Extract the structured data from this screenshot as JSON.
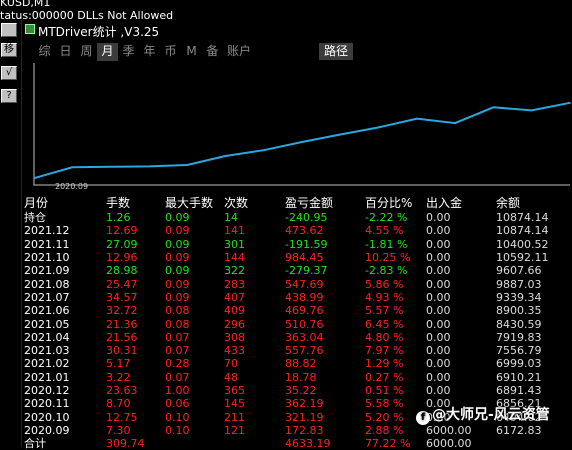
{
  "status": {
    "line1": "KUSD,M1",
    "line2": "tatus:000000 DLLs Not Allowed"
  },
  "side_buttons": [
    {
      "name": "side-button-1",
      "label": ""
    },
    {
      "name": "side-button-2",
      "label": "移"
    },
    {
      "name": "side-button-3",
      "label": "√"
    },
    {
      "name": "side-button-4",
      "label": "?"
    }
  ],
  "window": {
    "title": "MTDriver统计 ,V3.25"
  },
  "tabs": [
    "综",
    "日",
    "周",
    "月",
    "季",
    "年",
    "币",
    "M",
    "备",
    "账户"
  ],
  "active_tab": "月",
  "path_tab": "路径",
  "chart_data": {
    "type": "line",
    "x_tick_labels": [
      "2020.09"
    ],
    "series": [
      {
        "color": "#29a8e0",
        "values": [
          6172.83,
          6856.21,
          6891.43,
          6910.21,
          6999.03,
          7556.79,
          7919.83,
          8430.59,
          8900.35,
          9339.34,
          9887.03,
          9607.66,
          10592.11,
          10400.52,
          10874.14
        ]
      }
    ],
    "grid": false
  },
  "table": {
    "headers": [
      "月份",
      "手数",
      "最大手数",
      "次数",
      "盈亏金额",
      "百分比%",
      "出入金",
      "余额"
    ],
    "rows": [
      {
        "cells": [
          "持仓",
          "1.26",
          "0.09",
          "14",
          "-240.95",
          "-2.22 %",
          "0.00",
          "10874.14"
        ],
        "color": "green"
      },
      {
        "cells": [
          "2021.12",
          "12.69",
          "0.09",
          "141",
          "473.62",
          "4.55 %",
          "0.00",
          "10874.14"
        ],
        "color": "red"
      },
      {
        "cells": [
          "2021.11",
          "27.09",
          "0.09",
          "301",
          "-191.59",
          "-1.81 %",
          "0.00",
          "10400.52"
        ],
        "color": "green"
      },
      {
        "cells": [
          "2021.10",
          "12.96",
          "0.09",
          "144",
          "984.45",
          "10.25 %",
          "0.00",
          "10592.11"
        ],
        "color": "red"
      },
      {
        "cells": [
          "2021.09",
          "28.98",
          "0.09",
          "322",
          "-279.37",
          "-2.83 %",
          "0.00",
          "9607.66"
        ],
        "color": "green"
      },
      {
        "cells": [
          "2021.08",
          "25.47",
          "0.09",
          "283",
          "547.69",
          "5.86 %",
          "0.00",
          "9887.03"
        ],
        "color": "red"
      },
      {
        "cells": [
          "2021.07",
          "34.57",
          "0.09",
          "407",
          "438.99",
          "4.93 %",
          "0.00",
          "9339.34"
        ],
        "color": "red"
      },
      {
        "cells": [
          "2021.06",
          "32.72",
          "0.08",
          "409",
          "469.76",
          "5.57 %",
          "0.00",
          "8900.35"
        ],
        "color": "red"
      },
      {
        "cells": [
          "2021.05",
          "21.36",
          "0.08",
          "296",
          "510.76",
          "6.45 %",
          "0.00",
          "8430.59"
        ],
        "color": "red"
      },
      {
        "cells": [
          "2021.04",
          "21.56",
          "0.07",
          "308",
          "363.04",
          "4.80 %",
          "0.00",
          "7919.83"
        ],
        "color": "red"
      },
      {
        "cells": [
          "2021.03",
          "30.31",
          "0.07",
          "433",
          "557.76",
          "7.97 %",
          "0.00",
          "7556.79"
        ],
        "color": "red"
      },
      {
        "cells": [
          "2021.02",
          "5.17",
          "0.28",
          "70",
          "88.82",
          "1.29 %",
          "0.00",
          "6999.03"
        ],
        "color": "red"
      },
      {
        "cells": [
          "2021.01",
          "3.22",
          "0.07",
          "48",
          "18.78",
          "0.27 %",
          "0.00",
          "6910.21"
        ],
        "color": "red"
      },
      {
        "cells": [
          "2020.12",
          "23.63",
          "1.00",
          "365",
          "35.22",
          "0.51 %",
          "0.00",
          "6891.43"
        ],
        "color": "red"
      },
      {
        "cells": [
          "2020.11",
          "8.70",
          "0.06",
          "145",
          "362.19",
          "5.58 %",
          "0.00",
          "6856.21"
        ],
        "color": "red"
      },
      {
        "cells": [
          "2020.10",
          "12.75",
          "0.10",
          "211",
          "321.19",
          "5.20 %",
          "0.00",
          "6494.02"
        ],
        "color": "red"
      },
      {
        "cells": [
          "2020.09",
          "7.30",
          "0.10",
          "121",
          "172.83",
          "2.88 %",
          "6000.00",
          "6172.83"
        ],
        "color": "red"
      }
    ],
    "total": [
      "合计",
      "309.74",
      "",
      "",
      "4633.19",
      "77.22 %",
      "6000.00",
      ""
    ]
  },
  "watermark": "@大师兄-风云资管"
}
